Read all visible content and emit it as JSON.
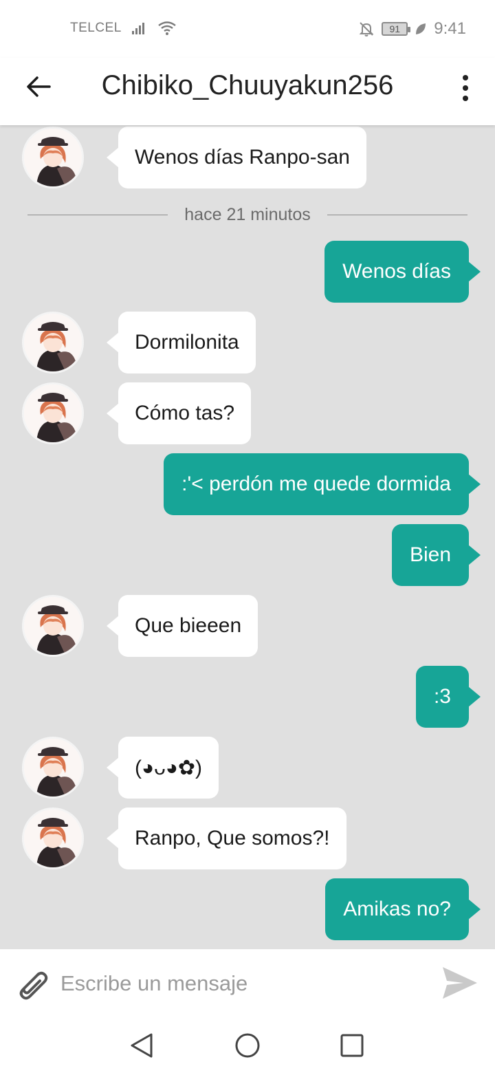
{
  "status": {
    "carrier": "TELCEL",
    "battery": "91",
    "time": "9:41",
    "icons": [
      "signal-icon",
      "wifi-icon",
      "bell-off-icon",
      "battery-icon",
      "leaf-icon"
    ]
  },
  "header": {
    "title": "Chibiko_Chuuyakun256",
    "back_icon": "arrow-left-icon",
    "menu_icon": "more-vert-icon"
  },
  "chat": {
    "timestamp": "hace 21 minutos",
    "messages": [
      {
        "side": "in",
        "text": "Wenos días Ranpo-san"
      },
      {
        "side": "out",
        "text": "Wenos días"
      },
      {
        "side": "in",
        "text": "Dormilonita"
      },
      {
        "side": "in",
        "text": "Cómo tas?"
      },
      {
        "side": "out",
        "text": ":'< perdón me quede dormida"
      },
      {
        "side": "out",
        "text": "Bien"
      },
      {
        "side": "in",
        "text": "Que bieeen"
      },
      {
        "side": "out",
        "text": ":3"
      },
      {
        "side": "in",
        "text": "(◕ᴗ◕✿)"
      },
      {
        "side": "in",
        "text": "Ranpo, Que somos?!"
      },
      {
        "side": "out",
        "text": "Amikas no?"
      }
    ]
  },
  "composer": {
    "placeholder": "Escribe un mensaje",
    "attach_icon": "paperclip-icon",
    "send_icon": "send-icon"
  },
  "colors": {
    "outgoing_bubble": "#17a597",
    "incoming_bubble": "#ffffff",
    "chat_background": "#e0e0e0"
  }
}
